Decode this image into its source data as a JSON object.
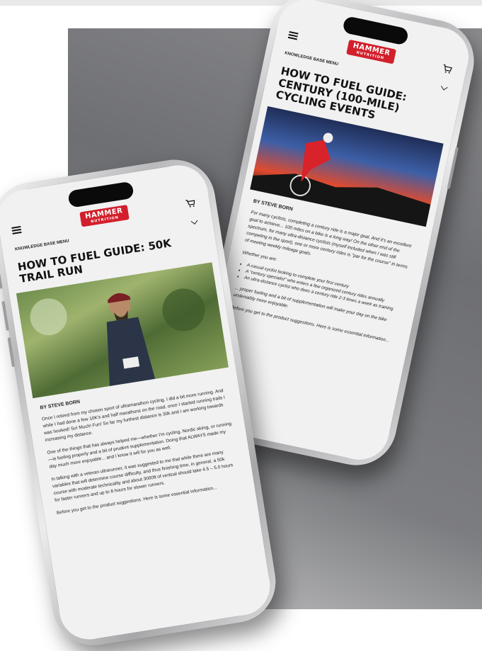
{
  "brand": {
    "logo_text": "HAMMER",
    "logo_sub": "NUTRITION",
    "accent": "#d21f2b"
  },
  "phone_left": {
    "nav_label": "KNOWLEDGE BASE MENU",
    "title": "HOW TO FUEL GUIDE: 50K TRAIL RUN",
    "author": "BY STEVE BORN",
    "paragraphs": [
      "Once I retired from my chosen sport of ultramarathon cycling, I did a bit more running. And while I had done a few 10K's and half marathons on the road, once I started running trails I was hooked! So! Much! Fun! So far my furthest distance is 30k and I am working towards increasing my distance.",
      "One of the things that has always helped me—whether I'm cycling, Nordic skiing, or running—is fueling properly and a bit of prudent supplementation. Doing that ALWAYS made my day much more enjoyable... and I know it will for you as well.",
      "In talking with a veteran ultrarunner, it was suggested to me that while there are many variables that will determine course difficulty, and thus finishing time, in general, a 50k course with moderate technicality and about 3000ft of vertical should take 4.5 – 5.0 hours for faster runners and up to 8 hours for slower runners.",
      "Before you get to the product suggestions. Here is some essential information..."
    ]
  },
  "phone_right": {
    "nav_label": "KNOWLEDGE BASE MENU",
    "title": "HOW TO FUEL GUIDE: CENTURY (100-MILE) CYCLING EVENTS",
    "author": "BY STEVE BORN",
    "intro": "For many cyclists, completing a century ride is a major goal. And it's an excellent goal to achieve... 100 miles on a bike is a long way! On the other end of the spectrum, for many ultra-distance cyclists (myself included when I was still competing in the sport), one or more century rides is \"par for the course\" in terms of meeting weekly mileage goals.",
    "whether": "Whether you are:",
    "bullets": [
      "A casual cyclist looking to complete your first century",
      "A \"century specialist\" who enters a few organized century rides annually",
      "An ultra-distance cyclist who does a century ride 2-3 times a week as training"
    ],
    "closing": "... proper fueling and a bit of supplementation will make your day on the bike undeniably more enjoyable.",
    "before": "Before you get to the product suggestions. Here is some essential information..."
  }
}
